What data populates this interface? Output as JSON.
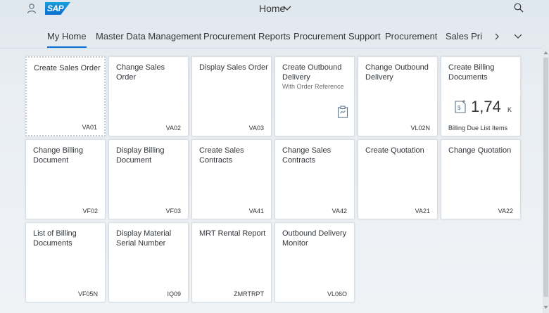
{
  "shell": {
    "logo_text": "SAP",
    "title": "Home"
  },
  "tabs": [
    {
      "label": "My Home"
    },
    {
      "label": "Master Data Management"
    },
    {
      "label": "Procurement Reports"
    },
    {
      "label": "Procurement Support"
    },
    {
      "label": "Procurement"
    },
    {
      "label": "Sales Prin"
    }
  ],
  "tiles": [
    {
      "title": "Create Sales Order",
      "footer": "VA01"
    },
    {
      "title": "Change Sales Order",
      "footer": "VA02"
    },
    {
      "title": "Display Sales Order",
      "footer": "VA03"
    },
    {
      "title": "Create Outbound Delivery",
      "subtitle": "With Order Reference"
    },
    {
      "title": "Change Outbound Delivery",
      "footer": "VL02N"
    },
    {
      "title": "Create Billing Documents",
      "kpi_value": "1,74",
      "kpi_unit": "K",
      "footer": "Billing Due List Items"
    },
    {
      "title": "Change Billing Document",
      "footer": "VF02"
    },
    {
      "title": "Display Billing Document",
      "footer": "VF03"
    },
    {
      "title": "Create Sales Contracts",
      "footer": "VA41"
    },
    {
      "title": "Change Sales Contracts",
      "footer": "VA42"
    },
    {
      "title": "Create Quotation",
      "footer": "VA21"
    },
    {
      "title": "Change Quotation",
      "footer": "VA22"
    },
    {
      "title": "List of Billing Documents",
      "footer": "VF05N"
    },
    {
      "title": "Display Material Serial Number",
      "footer": "IQ09"
    },
    {
      "title": "MRT Rental Report",
      "footer": "ZMRTRPT"
    },
    {
      "title": "Outbound Delivery Monitor",
      "footer": "VL06O"
    }
  ],
  "colors": {
    "accent": "#0a6ed1",
    "tile_bg": "#ffffff",
    "icon": "#5b738b"
  },
  "icons": {
    "user": "person-icon",
    "search": "magnifier-icon",
    "kpi": "billing-document-icon",
    "ref": "clipboard-icon"
  }
}
